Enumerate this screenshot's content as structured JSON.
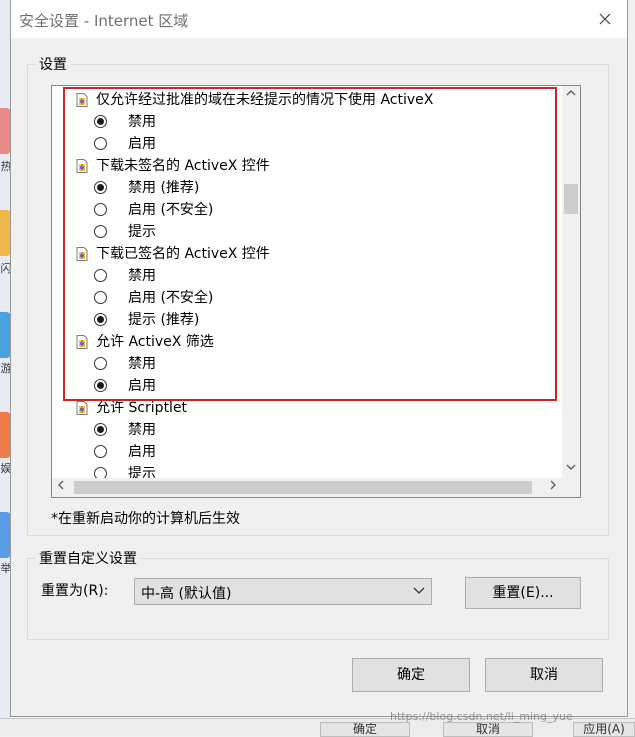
{
  "window": {
    "title": "安全设置 - Internet 区域"
  },
  "settings_group": {
    "label": "设置",
    "items": [
      {
        "kind": "category",
        "label": "仅允许经过批准的域在未经提示的情况下使用 ActiveX"
      },
      {
        "kind": "option",
        "label": "禁用",
        "selected": true
      },
      {
        "kind": "option",
        "label": "启用",
        "selected": false
      },
      {
        "kind": "category",
        "label": "下载未签名的 ActiveX 控件"
      },
      {
        "kind": "option",
        "label": "禁用 (推荐)",
        "selected": true
      },
      {
        "kind": "option",
        "label": "启用 (不安全)",
        "selected": false
      },
      {
        "kind": "option",
        "label": "提示",
        "selected": false
      },
      {
        "kind": "category",
        "label": "下载已签名的 ActiveX 控件"
      },
      {
        "kind": "option",
        "label": "禁用",
        "selected": false
      },
      {
        "kind": "option",
        "label": "启用 (不安全)",
        "selected": false
      },
      {
        "kind": "option",
        "label": "提示 (推荐)",
        "selected": true
      },
      {
        "kind": "category",
        "label": "允许 ActiveX 筛选"
      },
      {
        "kind": "option",
        "label": "禁用",
        "selected": false
      },
      {
        "kind": "option",
        "label": "启用",
        "selected": true
      },
      {
        "kind": "category",
        "label": "允许 Scriptlet"
      },
      {
        "kind": "option",
        "label": "禁用",
        "selected": true
      },
      {
        "kind": "option",
        "label": "启用",
        "selected": false
      },
      {
        "kind": "option",
        "label": "提示",
        "selected": false
      }
    ],
    "note": "*在重新启动你的计算机后生效"
  },
  "reset_group": {
    "label": "重置自定义设置",
    "reset_to_label": "重置为(R):",
    "selected_level": "中-高 (默认值)",
    "reset_button": "重置(E)..."
  },
  "footer": {
    "ok_label": "确定",
    "cancel_label": "取消"
  },
  "background": {
    "side_chars": [
      "热",
      "闪",
      "游",
      "娱",
      "举"
    ],
    "bottom_buttons": [
      "确定",
      "取消",
      "应用(A)"
    ],
    "watermark": "https://blog.csdn.net/li_ming_yue"
  },
  "colors": {
    "highlight": "#d2232a"
  }
}
